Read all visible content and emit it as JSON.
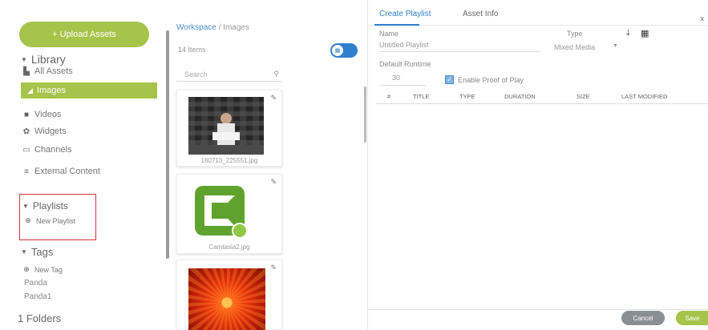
{
  "sidebar": {
    "upload_label": "+ Upload Assets",
    "library_label": "Library",
    "items": [
      {
        "label": "All Assets",
        "icon": "file-icon"
      },
      {
        "label": "Images",
        "icon": "image-icon",
        "active": true
      },
      {
        "label": "Videos",
        "icon": "video-icon"
      },
      {
        "label": "Widgets",
        "icon": "widget-icon"
      },
      {
        "label": "Channels",
        "icon": "channel-icon"
      },
      {
        "label": "External Content",
        "icon": "external-content-icon"
      }
    ],
    "playlists_label": "Playlists",
    "new_playlist_label": "New Playlist",
    "tags_label": "Tags",
    "new_tag_label": "New Tag",
    "tag_items": [
      "Panda",
      "Panda1"
    ],
    "folders_label": "1 Folders"
  },
  "assets": {
    "breadcrumb_root": "Workspace",
    "breadcrumb_sep": "/",
    "breadcrumb_current": "Images",
    "item_count": "14 Items",
    "search_placeholder": "Search",
    "tiles": [
      {
        "name": "160713_225551.jpg"
      },
      {
        "name": "Camtasia2.jpg"
      },
      {
        "name": ""
      }
    ]
  },
  "panel": {
    "tabs": [
      "Create Playlist",
      "Asset Info"
    ],
    "close": "x",
    "name_label": "Name",
    "name_value": "Untitled Playlist",
    "type_label": "Type",
    "type_value": "Mixed Media",
    "runtime_label": "Default Runtime",
    "runtime_value": "30",
    "proof_label": "Enable Proof of Play",
    "columns": [
      "#",
      "TITLE",
      "TYPE",
      "DURATION",
      "SIZE",
      "LAST MODIFIED"
    ],
    "cancel_label": "Cancel",
    "save_label": "Save"
  },
  "colors": {
    "accent_green": "#a6c34a",
    "accent_blue": "#2f7fcf",
    "highlight_red": "#d9343a"
  }
}
